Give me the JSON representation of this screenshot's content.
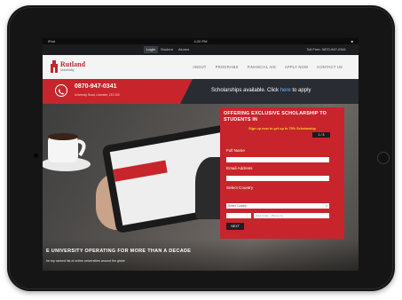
{
  "status_bar": {
    "carrier": "iPad",
    "time": "4:20 PM",
    "battery": "■"
  },
  "util_bar": {
    "tabs": [
      "Login",
      "Student",
      "Alumni"
    ],
    "phone": "Toll Free: 0870-947-0341"
  },
  "header": {
    "logo_name": "Rutland",
    "logo_sub": "University",
    "nav": [
      "ABOUT",
      "PROGRAMS",
      "FINANCIAL AID",
      "APPLY NOW",
      "CONTACT US"
    ]
  },
  "contact_band": {
    "phone": "0870-947-0341",
    "address": "University Road, Leicester, LE1 000",
    "scholarship_text": "Scholarships available. Click ",
    "scholarship_link": "here",
    "scholarship_suffix": " to apply"
  },
  "hero": {
    "headline": "E UNIVERSITY OPERATING FOR MORE THAN A DECADE",
    "subline": "he top ranked list of online universities around the globe"
  },
  "form": {
    "title": "OFFERING EXCLUSIVE SCHOLARSHIP TO STUDENTS IN",
    "signup": "Sign up now to get up to 75% Scholarship",
    "countdown": "1 / 3",
    "full_name_label": "Full Name",
    "email_label": "Email Address",
    "country_label": "Select Country",
    "country_select": "Select Country",
    "phone_placeholder": "Area Code + Phone no.",
    "next_button": "NEXT"
  },
  "colors": {
    "brand_red": "#c7252b",
    "dark_band": "#2a2c33",
    "link_blue": "#5fb6ff",
    "highlight_yellow": "#ffd23c"
  }
}
